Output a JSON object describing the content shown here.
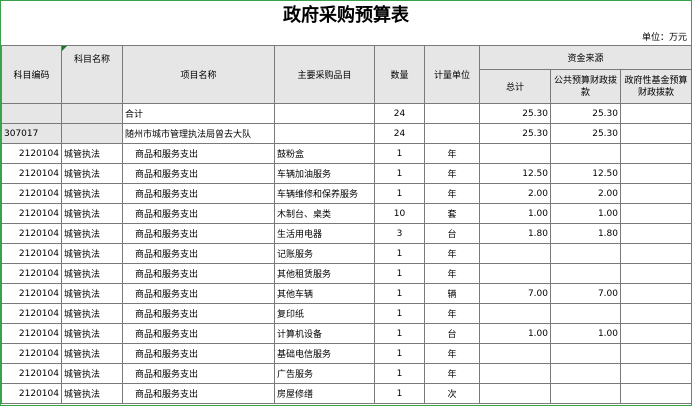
{
  "title": "政府采购预算表",
  "unit": "单位：万元",
  "headers": {
    "subject_code": "科目编码",
    "subject_name": "科目名称",
    "item_name": "项目名称",
    "procurement": "主要采购品目",
    "quantity": "数量",
    "measure_unit": "计量单位",
    "fund_source": "资金来源",
    "total": "总计",
    "public_budget": "公共预算财政拨款",
    "gov_fund": "政府性基金预算财政拨款"
  },
  "summary_row": {
    "item": "合计",
    "qty": "24",
    "total": "25.30",
    "public": "25.30"
  },
  "unit_row": {
    "code": "307017",
    "item": "随州市城市管理执法局曾去大队",
    "qty": "24",
    "total": "25.30",
    "public": "25.30"
  },
  "rows": [
    {
      "code": "2120104",
      "subject": "城管执法",
      "item": "商品和服务支出",
      "proc": "鼓粉盒",
      "qty": "1",
      "unit": "年",
      "total": "",
      "public": ""
    },
    {
      "code": "2120104",
      "subject": "城管执法",
      "item": "商品和服务支出",
      "proc": "车辆加油服务",
      "qty": "1",
      "unit": "年",
      "total": "12.50",
      "public": "12.50"
    },
    {
      "code": "2120104",
      "subject": "城管执法",
      "item": "商品和服务支出",
      "proc": "车辆维修和保养服务",
      "qty": "1",
      "unit": "年",
      "total": "2.00",
      "public": "2.00"
    },
    {
      "code": "2120104",
      "subject": "城管执法",
      "item": "商品和服务支出",
      "proc": "木制台、桌类",
      "qty": "10",
      "unit": "套",
      "total": "1.00",
      "public": "1.00"
    },
    {
      "code": "2120104",
      "subject": "城管执法",
      "item": "商品和服务支出",
      "proc": "生活用电器",
      "qty": "3",
      "unit": "台",
      "total": "1.80",
      "public": "1.80"
    },
    {
      "code": "2120104",
      "subject": "城管执法",
      "item": "商品和服务支出",
      "proc": "记账服务",
      "qty": "1",
      "unit": "年",
      "total": "",
      "public": ""
    },
    {
      "code": "2120104",
      "subject": "城管执法",
      "item": "商品和服务支出",
      "proc": "其他租赁服务",
      "qty": "1",
      "unit": "年",
      "total": "",
      "public": ""
    },
    {
      "code": "2120104",
      "subject": "城管执法",
      "item": "商品和服务支出",
      "proc": "其他车辆",
      "qty": "1",
      "unit": "辆",
      "total": "7.00",
      "public": "7.00"
    },
    {
      "code": "2120104",
      "subject": "城管执法",
      "item": "商品和服务支出",
      "proc": "复印纸",
      "qty": "1",
      "unit": "年",
      "total": "",
      "public": ""
    },
    {
      "code": "2120104",
      "subject": "城管执法",
      "item": "商品和服务支出",
      "proc": "计算机设备",
      "qty": "1",
      "unit": "台",
      "total": "1.00",
      "public": "1.00"
    },
    {
      "code": "2120104",
      "subject": "城管执法",
      "item": "商品和服务支出",
      "proc": "基础电信服务",
      "qty": "1",
      "unit": "年",
      "total": "",
      "public": ""
    },
    {
      "code": "2120104",
      "subject": "城管执法",
      "item": "商品和服务支出",
      "proc": "广告服务",
      "qty": "1",
      "unit": "年",
      "total": "",
      "public": ""
    },
    {
      "code": "2120104",
      "subject": "城管执法",
      "item": "商品和服务支出",
      "proc": "房屋修缮",
      "qty": "1",
      "unit": "次",
      "total": "",
      "public": ""
    }
  ],
  "colors": {
    "frame": "#36a24a",
    "header_bg": "#e6e6e6",
    "grid": "#7a7a7a"
  }
}
